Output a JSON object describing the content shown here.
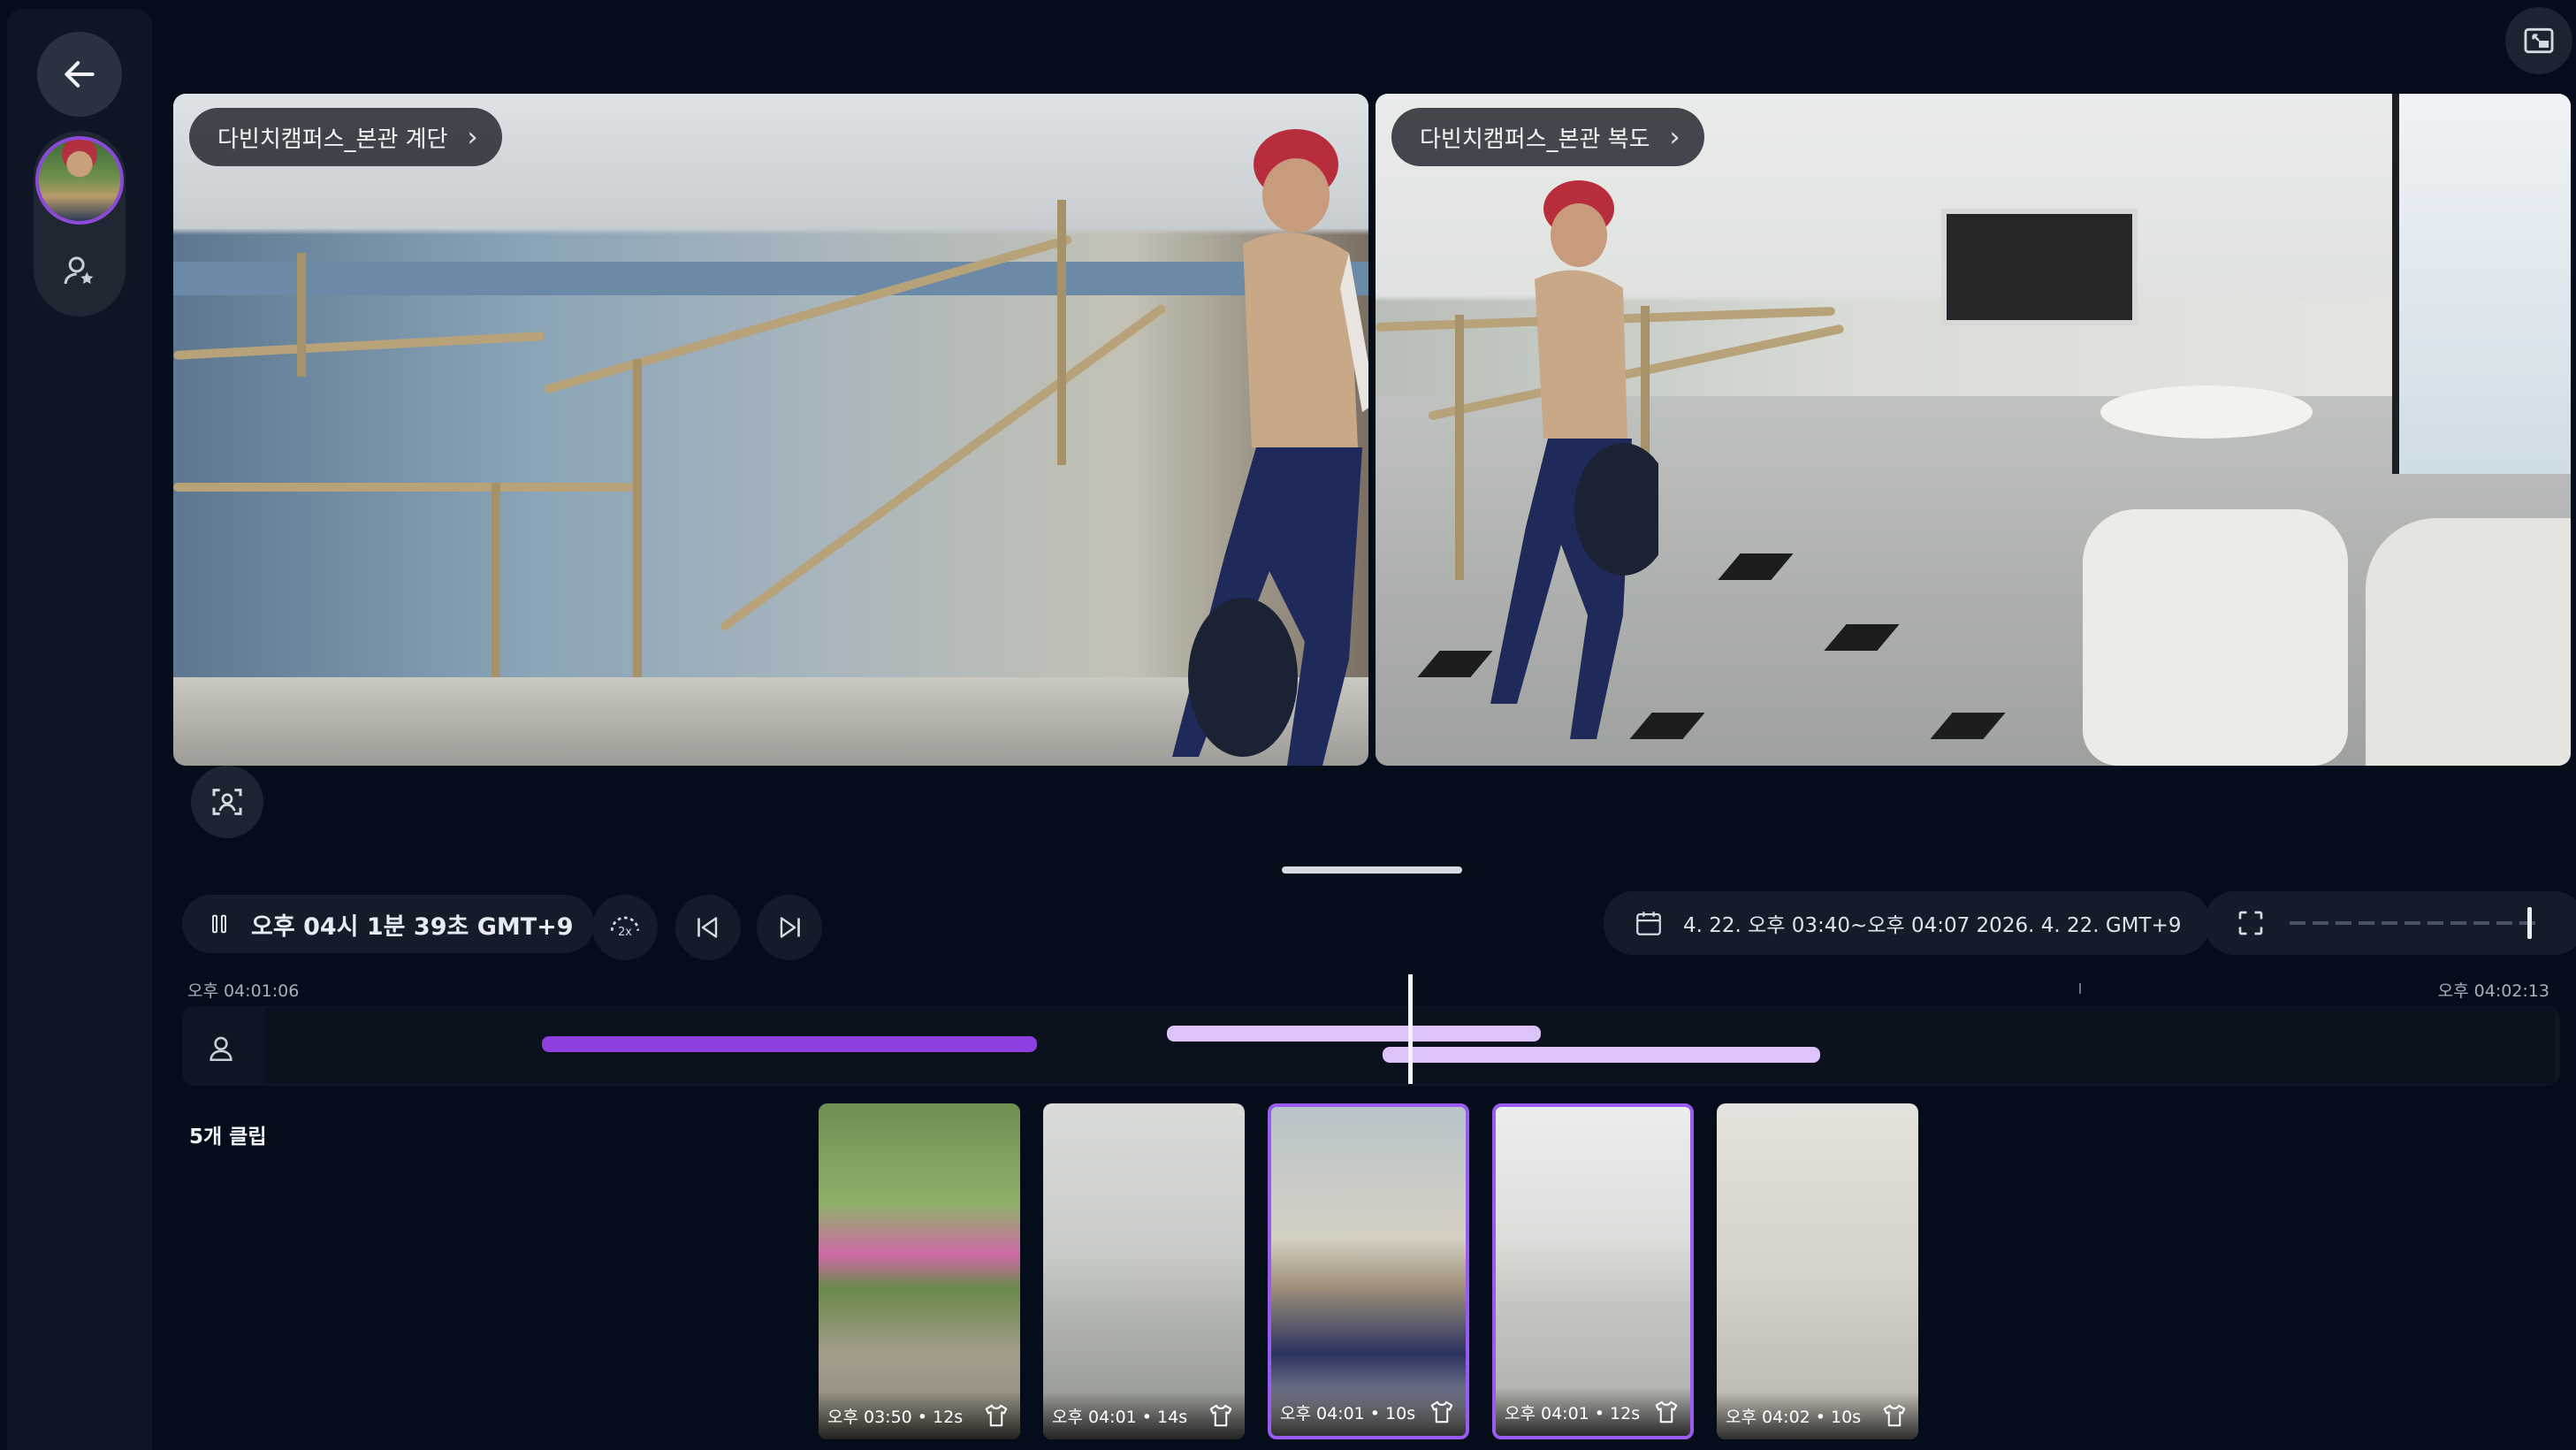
{
  "cameras": {
    "left_label": "다빈치캠퍼스_본관 계단",
    "right_label": "다빈치캠퍼스_본관 복도"
  },
  "playback": {
    "current_time": "오후 04시 1분 39초 GMT+9",
    "speed": "2x"
  },
  "date_range": "4. 22. 오후 03:40~오후 04:07 2026. 4. 22. GMT+9",
  "timeline": {
    "start_label": "오후 04:01:06",
    "end_label": "오후 04:02:13",
    "segments": [
      {
        "start": 0.121,
        "end": 0.337,
        "row": "middle",
        "color": "#8e3fe0"
      },
      {
        "start": 0.394,
        "end": 0.557,
        "row": "upper",
        "color": "#dcc4fb"
      },
      {
        "start": 0.488,
        "end": 0.679,
        "row": "lower",
        "color": "#dcc4fb"
      }
    ],
    "playhead": 0.5
  },
  "clips": {
    "count_label": "5개 클립",
    "items": [
      {
        "caption": "오후 03:50 • 12s",
        "selected": false
      },
      {
        "caption": "오후 04:01 • 14s",
        "selected": false
      },
      {
        "caption": "오후 04:01 • 10s",
        "selected": true
      },
      {
        "caption": "오후 04:01 • 12s",
        "selected": true
      },
      {
        "caption": "오후 04:02 • 10s",
        "selected": false
      }
    ]
  },
  "colors": {
    "accent": "#8e3fe0",
    "accent_light": "#dcc4fb",
    "background": "#050d1b"
  },
  "icons": [
    "back-arrow-icon",
    "person-star-icon",
    "picture-in-picture-icon",
    "face-scan-icon",
    "pause-icon",
    "speed-icon",
    "step-back-icon",
    "step-forward-icon",
    "calendar-icon",
    "expand-icon",
    "shirt-icon",
    "person-icon",
    "chevron-right-icon"
  ]
}
